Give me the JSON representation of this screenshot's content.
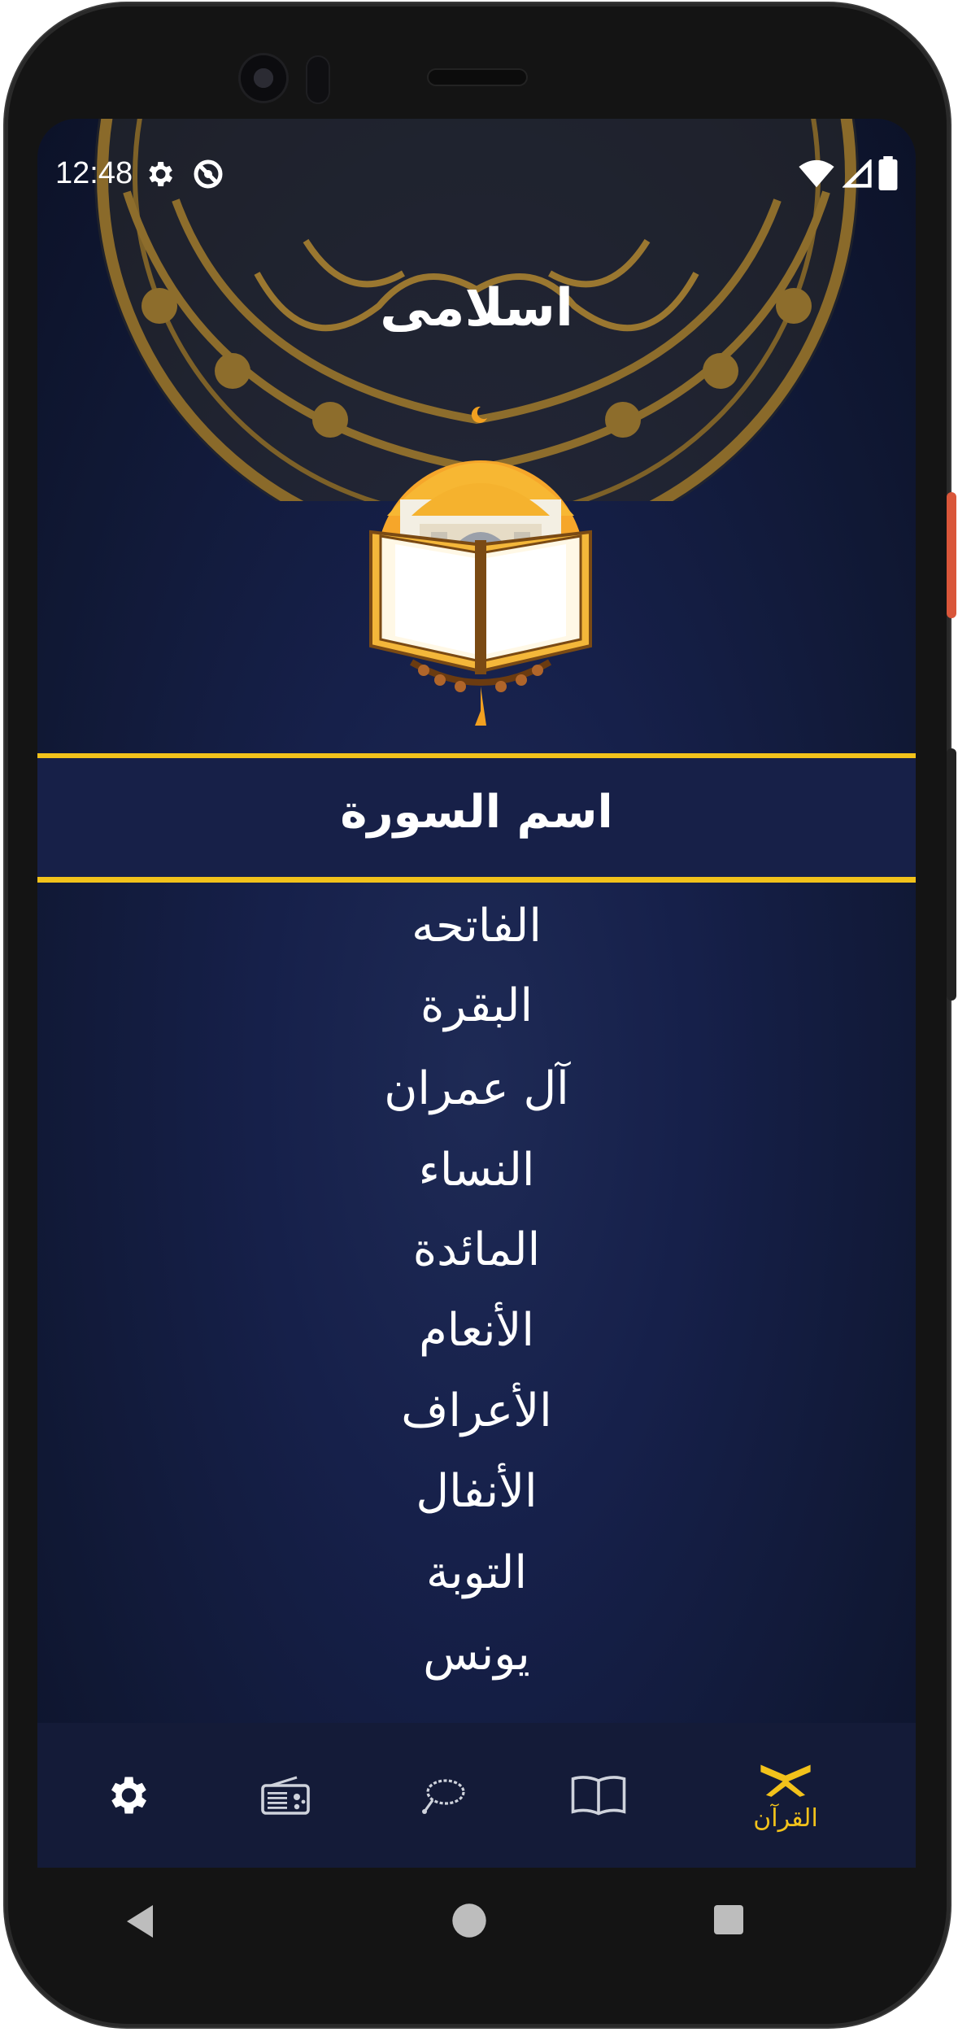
{
  "status_bar": {
    "time": "12:48",
    "left_icons": [
      "gear-icon",
      "data-saver-icon"
    ],
    "right_icons": [
      "wifi-icon",
      "signal-icon",
      "battery-icon"
    ]
  },
  "app": {
    "title": "اسلامى"
  },
  "list_header": "اسم السورة",
  "suras": [
    "الفاتحه",
    "البقرة",
    "آل عمران",
    "النساء",
    "المائدة",
    "الأنعام",
    "الأعراف",
    "الأنفال",
    "التوبة",
    "يونس"
  ],
  "bottom_nav": {
    "items": [
      {
        "icon": "settings-icon",
        "label": ""
      },
      {
        "icon": "radio-icon",
        "label": ""
      },
      {
        "icon": "sebha-icon",
        "label": ""
      },
      {
        "icon": "book-icon",
        "label": ""
      },
      {
        "icon": "quran-icon",
        "label": "القرآن"
      }
    ],
    "active_index": 4
  },
  "colors": {
    "accent": "#f2c21b",
    "background": "#16204a",
    "nav_background": "#141b38",
    "text": "#ffffff"
  }
}
